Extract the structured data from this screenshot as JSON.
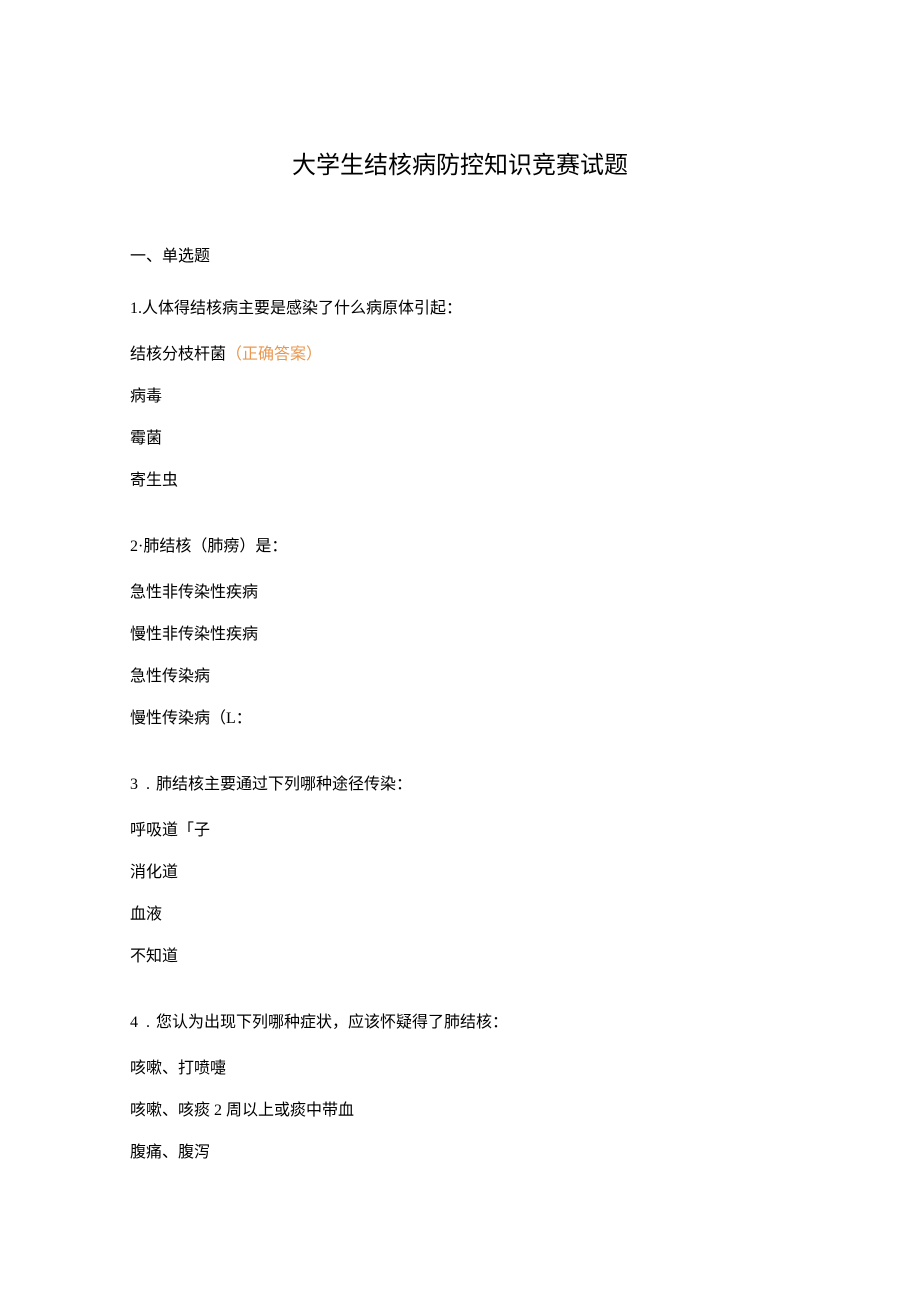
{
  "title": "大学生结核病防控知识竞赛试题",
  "section_header": "一、单选题",
  "questions": [
    {
      "num": "1.",
      "text": "人体得结核病主要是感染了什么病原体引起：",
      "options": [
        {
          "text": "结核分枝杆菌",
          "correct_label": "（正确答案）"
        },
        {
          "text": "病毒"
        },
        {
          "text": "霉菌"
        },
        {
          "text": "寄生虫"
        }
      ]
    },
    {
      "num": "2·",
      "text": "肺结核（肺痨）是：",
      "options": [
        {
          "text": "急性非传染性疾病"
        },
        {
          "text": "慢性非传染性疾病"
        },
        {
          "text": "急性传染病"
        },
        {
          "text": "慢性传染病（L："
        }
      ]
    },
    {
      "num": "3",
      "dot": ".",
      "text": "肺结核主要通过下列哪种途径传染：",
      "options": [
        {
          "text": "呼吸道「子"
        },
        {
          "text": "消化道"
        },
        {
          "text": "血液"
        },
        {
          "text": "不知道"
        }
      ]
    },
    {
      "num": "4",
      "dot": ".",
      "text": "您认为出现下列哪种症状，应该怀疑得了肺结核：",
      "options": [
        {
          "text": "咳嗽、打喷嚏"
        },
        {
          "text": "咳嗽、咳痰 2 周以上或痰中带血"
        },
        {
          "text": "腹痛、腹泻"
        }
      ]
    }
  ]
}
